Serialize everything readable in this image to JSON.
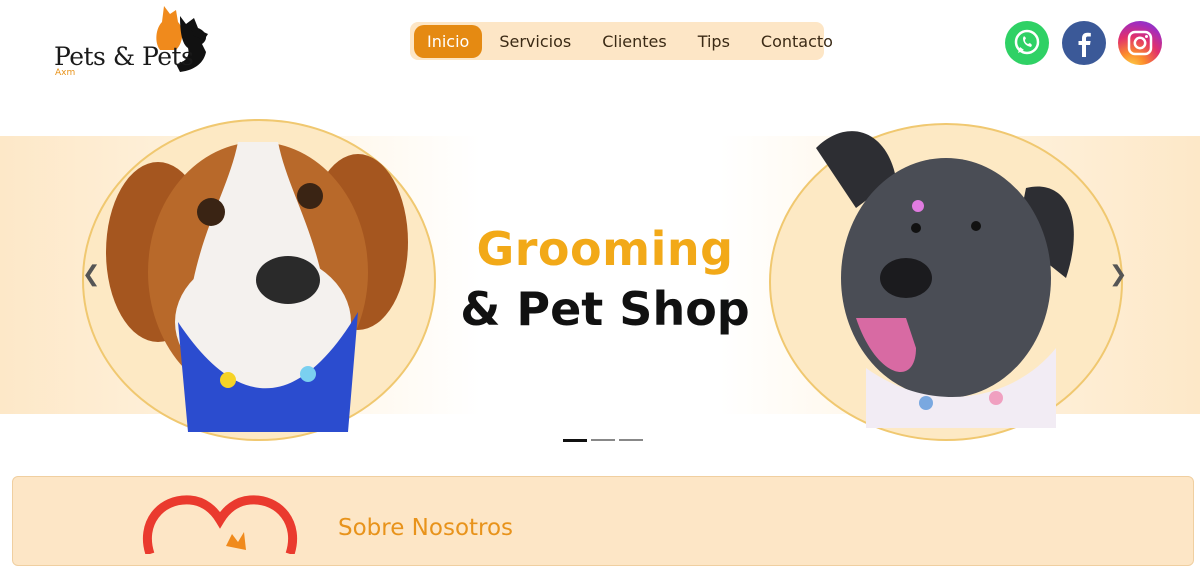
{
  "brand": {
    "name": "Pets & Pets",
    "sub": "Axm",
    "accent": "#e58a12"
  },
  "nav": {
    "items": [
      {
        "label": "Inicio",
        "active": true
      },
      {
        "label": "Servicios",
        "active": false
      },
      {
        "label": "Clientes",
        "active": false
      },
      {
        "label": "Tips",
        "active": false
      },
      {
        "label": "Contacto",
        "active": false
      }
    ]
  },
  "social": [
    {
      "name": "whatsapp",
      "color": "#2fd165"
    },
    {
      "name": "facebook",
      "color": "#3b5998"
    },
    {
      "name": "instagram",
      "color": "#e1306c"
    }
  ],
  "hero": {
    "title": "Grooming",
    "subtitle": "& Pet Shop",
    "prev_icon": "chevron-left-icon",
    "next_icon": "chevron-right-icon",
    "slides": 3,
    "active_slide": 1
  },
  "about": {
    "title": "Sobre Nosotros"
  }
}
